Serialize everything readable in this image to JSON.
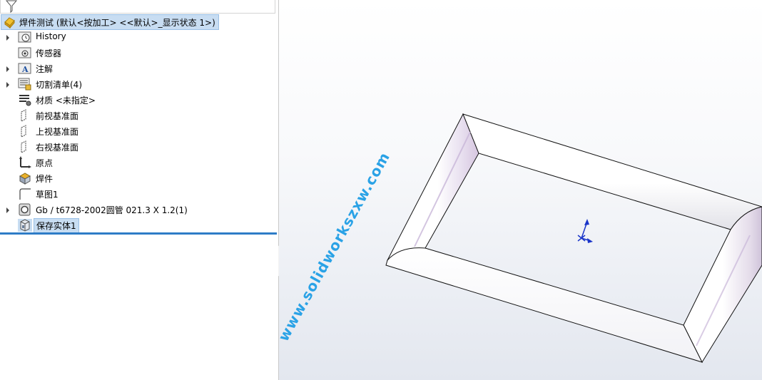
{
  "tree": {
    "root_label": "焊件测试  (默认<按加工> <<默认>_显示状态 1>)",
    "items": [
      {
        "label": "History",
        "icon": "history-folder-icon",
        "expandable": true
      },
      {
        "label": "传感器",
        "icon": "sensors-folder-icon",
        "expandable": false
      },
      {
        "label": "注解",
        "icon": "annotations-folder-icon",
        "expandable": true
      },
      {
        "label": "切割清单(4)",
        "icon": "cut-list-icon",
        "expandable": true
      },
      {
        "label": "材质 <未指定>",
        "icon": "material-icon",
        "expandable": false
      },
      {
        "label": "前视基准面",
        "icon": "plane-icon",
        "expandable": false
      },
      {
        "label": "上视基准面",
        "icon": "plane-icon",
        "expandable": false
      },
      {
        "label": "右视基准面",
        "icon": "plane-icon",
        "expandable": false
      },
      {
        "label": "原点",
        "icon": "origin-icon",
        "expandable": false
      },
      {
        "label": "焊件",
        "icon": "weldment-icon",
        "expandable": false
      },
      {
        "label": "草图1",
        "icon": "sketch-icon",
        "expandable": false
      },
      {
        "label": "Gb / t6728-2002圆管 021.3 X 1.2(1)",
        "icon": "structural-member-icon",
        "expandable": true
      },
      {
        "label": "保存实体1",
        "icon": "save-bodies-icon",
        "expandable": false,
        "selected": true
      }
    ]
  },
  "viewport": {
    "watermark": "www.solidworkszxw.com",
    "accent_color": "#2e7cc7",
    "selection_color": "#c8ddf2",
    "triad_color": "#1a35c9"
  }
}
